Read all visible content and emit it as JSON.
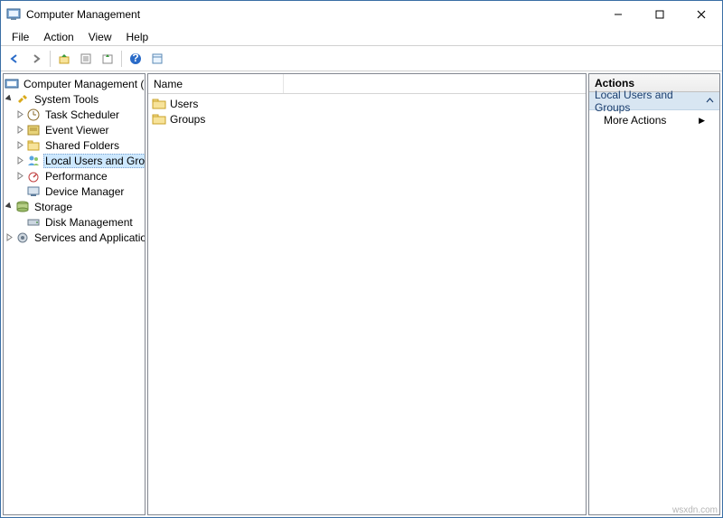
{
  "window": {
    "title": "Computer Management"
  },
  "menubar": {
    "items": [
      "File",
      "Action",
      "View",
      "Help"
    ]
  },
  "tree": {
    "root": "Computer Management (Local",
    "system_tools": "System Tools",
    "task_scheduler": "Task Scheduler",
    "event_viewer": "Event Viewer",
    "shared_folders": "Shared Folders",
    "local_users_groups": "Local Users and Groups",
    "performance": "Performance",
    "device_manager": "Device Manager",
    "storage": "Storage",
    "disk_management": "Disk Management",
    "services_apps": "Services and Applications"
  },
  "content": {
    "column_name": "Name",
    "items": [
      "Users",
      "Groups"
    ]
  },
  "actions": {
    "header": "Actions",
    "section": "Local Users and Groups",
    "more": "More Actions"
  },
  "watermark": "wsxdn.com"
}
